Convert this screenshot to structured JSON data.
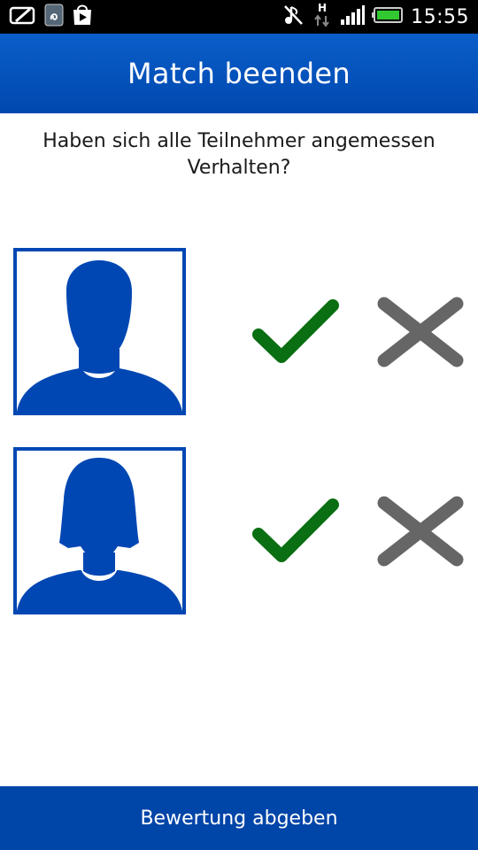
{
  "statusbar": {
    "time": "15:55",
    "network_type": "H",
    "icons": [
      "edit-icon",
      "app-icon",
      "play-store-icon",
      "muted-music-icon",
      "data-transfer-icon",
      "signal-icon",
      "battery-icon"
    ]
  },
  "header": {
    "title": "Match beenden"
  },
  "question": "Haben sich alle Teilnehmer angemessen Verhalten?",
  "participants": [
    {
      "avatar": "male-avatar-icon",
      "approve_icon": "checkmark-icon",
      "reject_icon": "cross-icon"
    },
    {
      "avatar": "female-avatar-icon",
      "approve_icon": "checkmark-icon",
      "reject_icon": "cross-icon"
    }
  ],
  "footer": {
    "submit_label": "Bewertung abgeben"
  },
  "colors": {
    "accent": "#0047b3",
    "header_top": "#0a5ec8",
    "check": "#0a6e12",
    "cross": "#666666",
    "footer": "#0045a8"
  }
}
